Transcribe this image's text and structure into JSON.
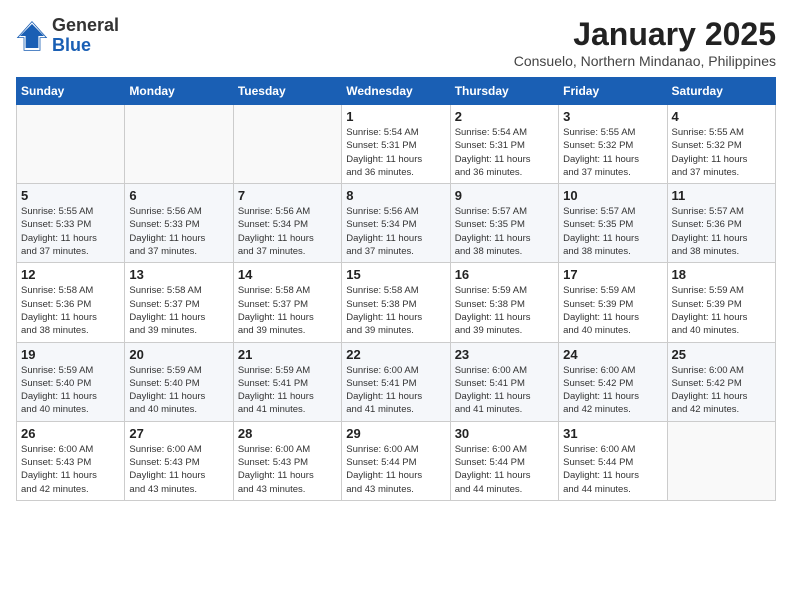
{
  "logo": {
    "general": "General",
    "blue": "Blue"
  },
  "title": "January 2025",
  "subtitle": "Consuelo, Northern Mindanao, Philippines",
  "weekdays": [
    "Sunday",
    "Monday",
    "Tuesday",
    "Wednesday",
    "Thursday",
    "Friday",
    "Saturday"
  ],
  "weeks": [
    [
      {
        "day": "",
        "info": ""
      },
      {
        "day": "",
        "info": ""
      },
      {
        "day": "",
        "info": ""
      },
      {
        "day": "1",
        "info": "Sunrise: 5:54 AM\nSunset: 5:31 PM\nDaylight: 11 hours\nand 36 minutes."
      },
      {
        "day": "2",
        "info": "Sunrise: 5:54 AM\nSunset: 5:31 PM\nDaylight: 11 hours\nand 36 minutes."
      },
      {
        "day": "3",
        "info": "Sunrise: 5:55 AM\nSunset: 5:32 PM\nDaylight: 11 hours\nand 37 minutes."
      },
      {
        "day": "4",
        "info": "Sunrise: 5:55 AM\nSunset: 5:32 PM\nDaylight: 11 hours\nand 37 minutes."
      }
    ],
    [
      {
        "day": "5",
        "info": "Sunrise: 5:55 AM\nSunset: 5:33 PM\nDaylight: 11 hours\nand 37 minutes."
      },
      {
        "day": "6",
        "info": "Sunrise: 5:56 AM\nSunset: 5:33 PM\nDaylight: 11 hours\nand 37 minutes."
      },
      {
        "day": "7",
        "info": "Sunrise: 5:56 AM\nSunset: 5:34 PM\nDaylight: 11 hours\nand 37 minutes."
      },
      {
        "day": "8",
        "info": "Sunrise: 5:56 AM\nSunset: 5:34 PM\nDaylight: 11 hours\nand 37 minutes."
      },
      {
        "day": "9",
        "info": "Sunrise: 5:57 AM\nSunset: 5:35 PM\nDaylight: 11 hours\nand 38 minutes."
      },
      {
        "day": "10",
        "info": "Sunrise: 5:57 AM\nSunset: 5:35 PM\nDaylight: 11 hours\nand 38 minutes."
      },
      {
        "day": "11",
        "info": "Sunrise: 5:57 AM\nSunset: 5:36 PM\nDaylight: 11 hours\nand 38 minutes."
      }
    ],
    [
      {
        "day": "12",
        "info": "Sunrise: 5:58 AM\nSunset: 5:36 PM\nDaylight: 11 hours\nand 38 minutes."
      },
      {
        "day": "13",
        "info": "Sunrise: 5:58 AM\nSunset: 5:37 PM\nDaylight: 11 hours\nand 39 minutes."
      },
      {
        "day": "14",
        "info": "Sunrise: 5:58 AM\nSunset: 5:37 PM\nDaylight: 11 hours\nand 39 minutes."
      },
      {
        "day": "15",
        "info": "Sunrise: 5:58 AM\nSunset: 5:38 PM\nDaylight: 11 hours\nand 39 minutes."
      },
      {
        "day": "16",
        "info": "Sunrise: 5:59 AM\nSunset: 5:38 PM\nDaylight: 11 hours\nand 39 minutes."
      },
      {
        "day": "17",
        "info": "Sunrise: 5:59 AM\nSunset: 5:39 PM\nDaylight: 11 hours\nand 40 minutes."
      },
      {
        "day": "18",
        "info": "Sunrise: 5:59 AM\nSunset: 5:39 PM\nDaylight: 11 hours\nand 40 minutes."
      }
    ],
    [
      {
        "day": "19",
        "info": "Sunrise: 5:59 AM\nSunset: 5:40 PM\nDaylight: 11 hours\nand 40 minutes."
      },
      {
        "day": "20",
        "info": "Sunrise: 5:59 AM\nSunset: 5:40 PM\nDaylight: 11 hours\nand 40 minutes."
      },
      {
        "day": "21",
        "info": "Sunrise: 5:59 AM\nSunset: 5:41 PM\nDaylight: 11 hours\nand 41 minutes."
      },
      {
        "day": "22",
        "info": "Sunrise: 6:00 AM\nSunset: 5:41 PM\nDaylight: 11 hours\nand 41 minutes."
      },
      {
        "day": "23",
        "info": "Sunrise: 6:00 AM\nSunset: 5:41 PM\nDaylight: 11 hours\nand 41 minutes."
      },
      {
        "day": "24",
        "info": "Sunrise: 6:00 AM\nSunset: 5:42 PM\nDaylight: 11 hours\nand 42 minutes."
      },
      {
        "day": "25",
        "info": "Sunrise: 6:00 AM\nSunset: 5:42 PM\nDaylight: 11 hours\nand 42 minutes."
      }
    ],
    [
      {
        "day": "26",
        "info": "Sunrise: 6:00 AM\nSunset: 5:43 PM\nDaylight: 11 hours\nand 42 minutes."
      },
      {
        "day": "27",
        "info": "Sunrise: 6:00 AM\nSunset: 5:43 PM\nDaylight: 11 hours\nand 43 minutes."
      },
      {
        "day": "28",
        "info": "Sunrise: 6:00 AM\nSunset: 5:43 PM\nDaylight: 11 hours\nand 43 minutes."
      },
      {
        "day": "29",
        "info": "Sunrise: 6:00 AM\nSunset: 5:44 PM\nDaylight: 11 hours\nand 43 minutes."
      },
      {
        "day": "30",
        "info": "Sunrise: 6:00 AM\nSunset: 5:44 PM\nDaylight: 11 hours\nand 44 minutes."
      },
      {
        "day": "31",
        "info": "Sunrise: 6:00 AM\nSunset: 5:44 PM\nDaylight: 11 hours\nand 44 minutes."
      },
      {
        "day": "",
        "info": ""
      }
    ]
  ]
}
